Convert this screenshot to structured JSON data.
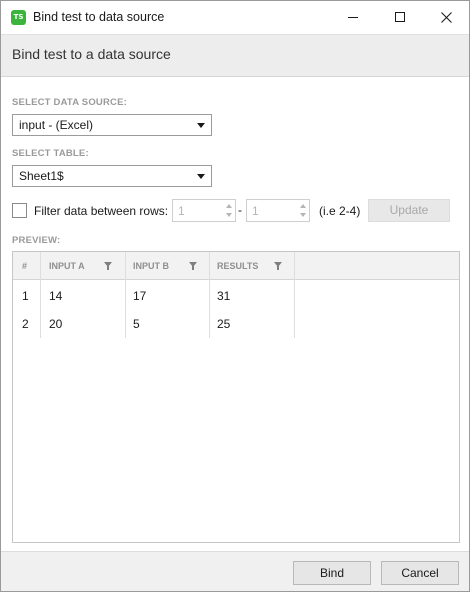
{
  "window": {
    "title": "Bind test to data source",
    "app_icon_text": "TS",
    "header": "Bind test to a data source"
  },
  "data_source": {
    "label": "SELECT DATA SOURCE:",
    "selected": "input - (Excel)"
  },
  "table": {
    "label": "SELECT TABLE:",
    "selected": "Sheet1$"
  },
  "filter": {
    "checked": false,
    "label": "Filter data between rows:",
    "from": "1",
    "dash": "-",
    "to": "1",
    "hint": "(i.e 2-4)",
    "update_label": "Update"
  },
  "preview": {
    "label": "PREVIEW:",
    "columns": [
      "#",
      "INPUT A",
      "INPUT B",
      "RESULTS"
    ],
    "rows": [
      [
        "1",
        "14",
        "17",
        "31"
      ],
      [
        "2",
        "20",
        "5",
        "25"
      ]
    ]
  },
  "footer": {
    "bind_label": "Bind",
    "cancel_label": "Cancel"
  },
  "colors": {
    "app_icon": "#3cb43c",
    "header_band": "#ededed"
  }
}
